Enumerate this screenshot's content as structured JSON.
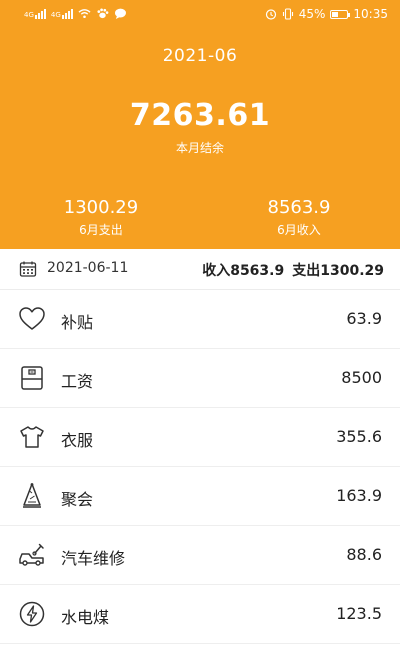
{
  "status_bar": {
    "battery": "45%",
    "time": "10:35",
    "battery_level": 0.45,
    "sim_tags": [
      "4G",
      "4G"
    ],
    "icons": [
      "signal-icon",
      "wifi-icon",
      "paw-icon",
      "chat-icon",
      "alarm-icon",
      "vibrate-icon",
      "battery-icon"
    ]
  },
  "header": {
    "month": "2021-06",
    "balance": "7263.61",
    "balance_label": "本月结余",
    "expense_value": "1300.29",
    "expense_label": "6月支出",
    "income_value": "8563.9",
    "income_label": "6月收入",
    "accent_color": "#f6a021"
  },
  "day": {
    "date": "2021-06-11",
    "income_total": "收入8563.9",
    "expense_total": "支出1300.29",
    "icon": "calendar-icon"
  },
  "transactions": [
    {
      "name": "补贴",
      "amount": "63.9",
      "icon": "heart-icon"
    },
    {
      "name": "工资",
      "amount": "8500",
      "icon": "wallet-icon"
    },
    {
      "name": "衣服",
      "amount": "355.6",
      "icon": "shirt-icon"
    },
    {
      "name": "聚会",
      "amount": "163.9",
      "icon": "party-hat-icon"
    },
    {
      "name": "汽车维修",
      "amount": "88.6",
      "icon": "car-wrench-icon"
    },
    {
      "name": "水电煤",
      "amount": "123.5",
      "icon": "utility-bolt-icon"
    }
  ]
}
